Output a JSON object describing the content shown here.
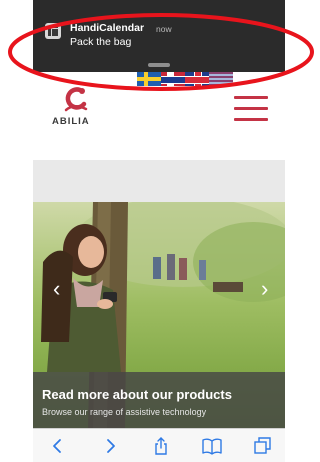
{
  "notification": {
    "app_name": "HandiCalendar",
    "time": "now",
    "message": "Pack the bag",
    "icon": "handicalendar-app-icon"
  },
  "site": {
    "logo_text": "ABILIA",
    "languages": [
      "Swedish",
      "Norwegian",
      "English (UK)",
      "English (US)"
    ],
    "menu_icon": "hamburger-menu-icon",
    "brand_color": "#c43345"
  },
  "hero": {
    "title": "Read more about our products",
    "subtitle": "Browse our range of assistive technology",
    "prev_icon": "chevron-left-icon",
    "next_icon": "chevron-right-icon"
  },
  "toolbar": {
    "items": [
      "back-icon",
      "forward-icon",
      "share-icon",
      "bookmarks-icon",
      "tabs-icon"
    ],
    "tint": "#2f7ae5"
  },
  "annotation_color": "#e8141c"
}
